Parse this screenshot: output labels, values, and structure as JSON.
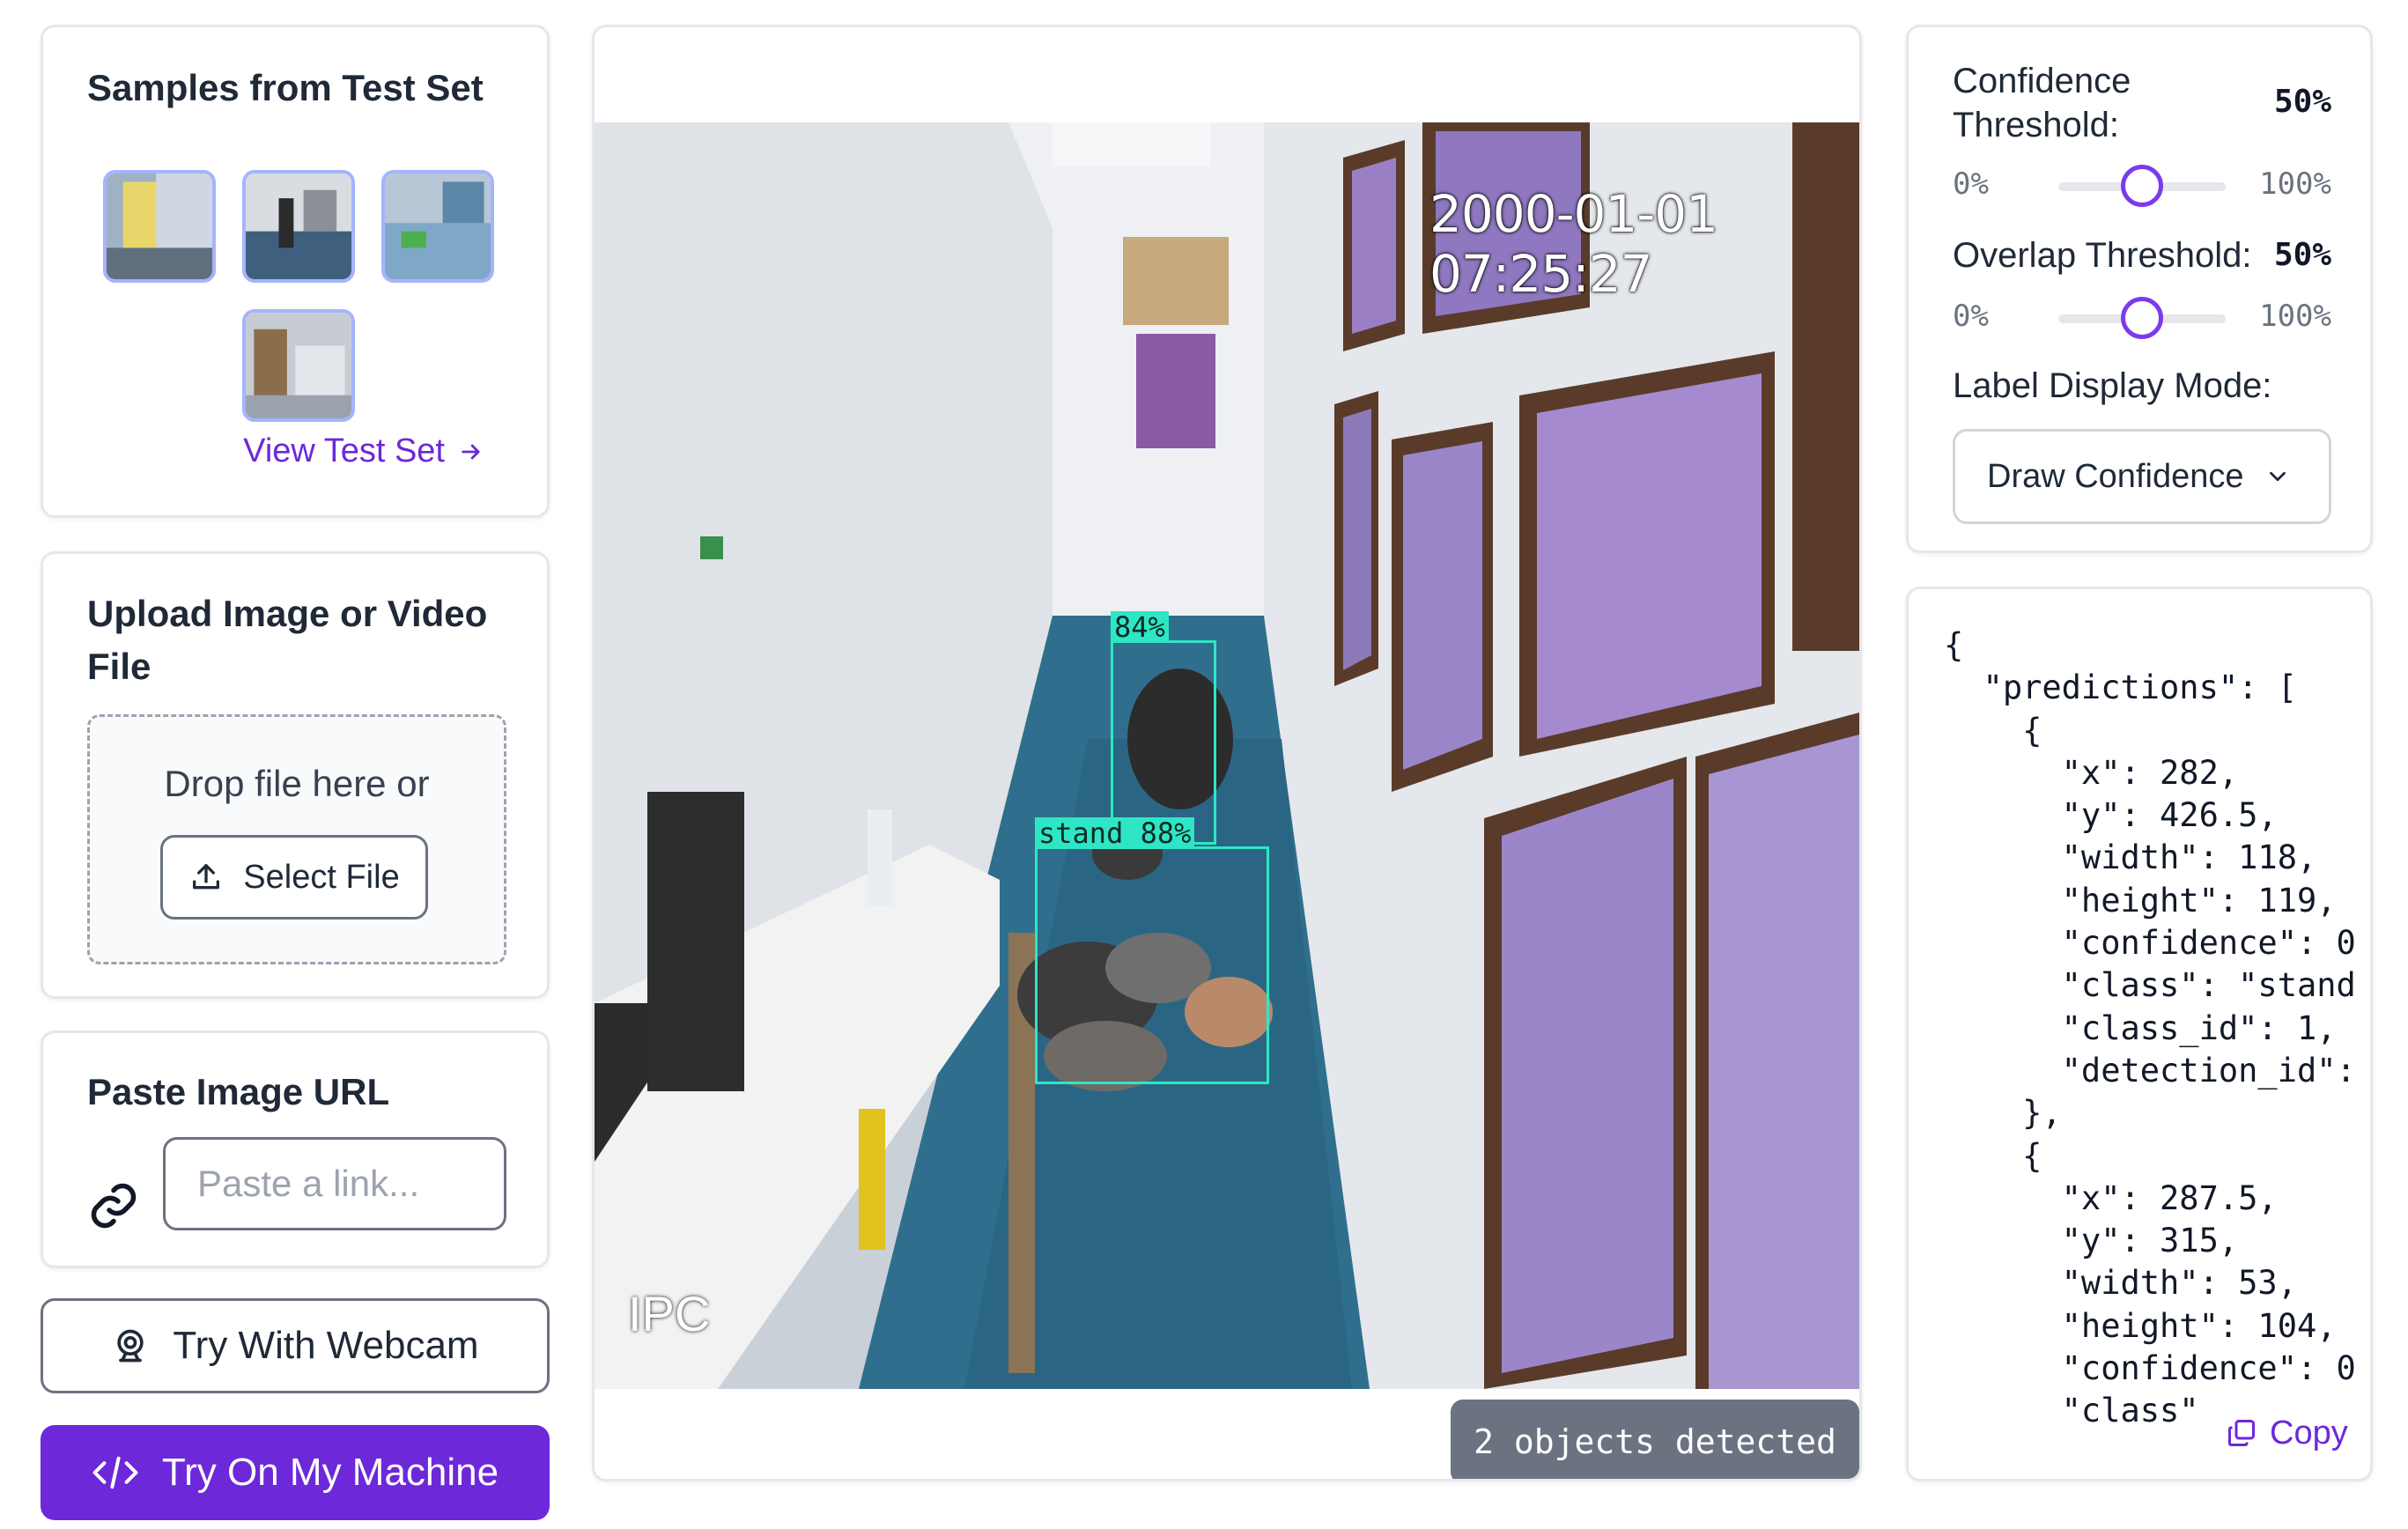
{
  "samples": {
    "title": "Samples from Test Set",
    "view_link": "View Test Set",
    "thumbnails": [
      {
        "name": "sample-1",
        "color": "#e8d66a"
      },
      {
        "name": "sample-2",
        "color": "#4a6a88"
      },
      {
        "name": "sample-3",
        "color": "#7fa7c6"
      },
      {
        "name": "sample-4",
        "color": "#c7ccd3"
      }
    ]
  },
  "upload": {
    "title": "Upload Image or Video File",
    "drop_text": "Drop file here or",
    "select_label": "Select File"
  },
  "url": {
    "title": "Paste Image URL",
    "placeholder": "Paste a link..."
  },
  "actions": {
    "webcam_label": "Try With Webcam",
    "machine_label": "Try On My Machine"
  },
  "viewer": {
    "timestamp": "2000-01-01 07:25:27",
    "camera_tag": "IPC",
    "detections": [
      {
        "label": "84%"
      },
      {
        "label": "stand 88%"
      }
    ],
    "status": "2 objects detected"
  },
  "settings": {
    "confidence_label": "Confidence Threshold:",
    "confidence_value": "50%",
    "confidence_fraction": 0.5,
    "overlap_label": "Overlap Threshold:",
    "overlap_value": "50%",
    "overlap_fraction": 0.5,
    "min_label": "0%",
    "max_label": "100%",
    "mode_label": "Label Display Mode:",
    "mode_value": "Draw Confidence"
  },
  "json_output": {
    "text": "{\n  \"predictions\": [\n    {\n      \"x\": 282,\n      \"y\": 426.5,\n      \"width\": 118,\n      \"height\": 119,\n      \"confidence\": 0\n      \"class\": \"stand\n      \"class_id\": 1,\n      \"detection_id\":\n    },\n    {\n      \"x\": 287.5,\n      \"y\": 315,\n      \"width\": 53,\n      \"height\": 104,\n      \"confidence\": 0\n      \"class\"",
    "copy_label": "Copy"
  },
  "colors": {
    "accent": "#6d28d9",
    "box": "#2ee6c6",
    "badge": "#6b7280"
  }
}
